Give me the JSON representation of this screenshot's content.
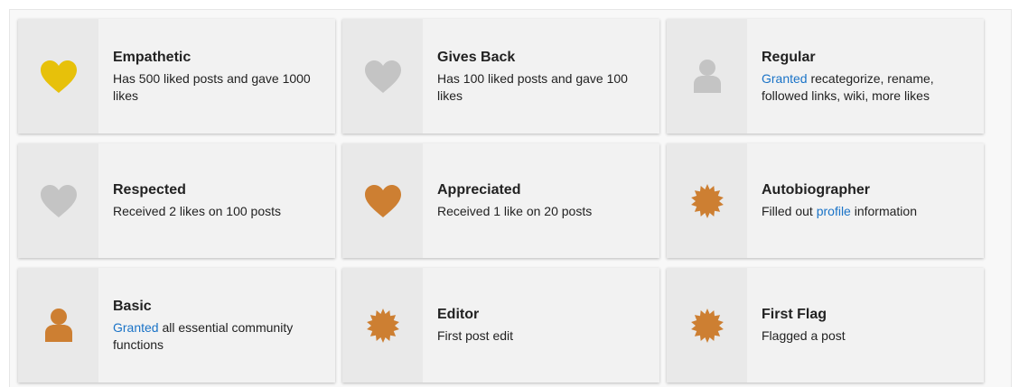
{
  "colors": {
    "gold": "#e7c10a",
    "bronze": "#cd7f32",
    "grey": "#c4c4c4",
    "link": "#1a73c7"
  },
  "badges": [
    {
      "title": "Empathetic",
      "icon": "heart-icon",
      "color": "gold",
      "description": "Has 500 liked posts and gave 1000 likes"
    },
    {
      "title": "Gives Back",
      "icon": "heart-icon",
      "color": "grey",
      "description": "Has 100 liked posts and gave 100 likes"
    },
    {
      "title": "Regular",
      "icon": "user-icon",
      "color": "grey",
      "link_text": "Granted",
      "description_rest": " recategorize, rename, followed links, wiki, more likes"
    },
    {
      "title": "Respected",
      "icon": "heart-icon",
      "color": "grey",
      "description": "Received 2 likes on 100 posts"
    },
    {
      "title": "Appreciated",
      "icon": "heart-icon",
      "color": "bronze",
      "description": "Received 1 like on 20 posts"
    },
    {
      "title": "Autobiographer",
      "icon": "certificate-icon",
      "color": "bronze",
      "description_pre": "Filled out ",
      "link_text": "profile",
      "description_rest": " information"
    },
    {
      "title": "Basic",
      "icon": "user-icon",
      "color": "bronze",
      "link_text": "Granted",
      "description_rest": " all essential community functions"
    },
    {
      "title": "Editor",
      "icon": "certificate-icon",
      "color": "bronze",
      "description": "First post edit"
    },
    {
      "title": "First Flag",
      "icon": "certificate-icon",
      "color": "bronze",
      "description": "Flagged a post"
    }
  ]
}
